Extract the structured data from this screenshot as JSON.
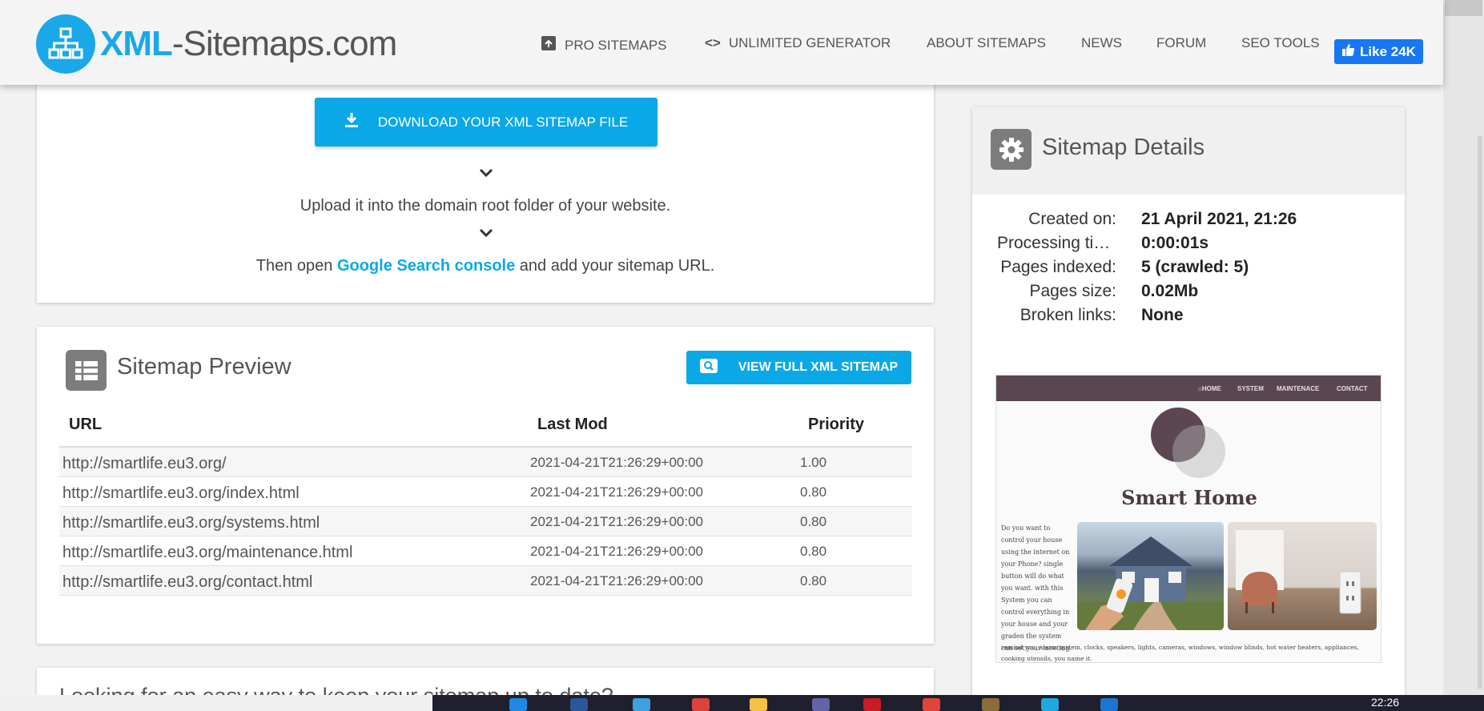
{
  "header": {
    "logo_part1": "XML",
    "logo_part2": "-Sitemaps.com",
    "nav": [
      {
        "label": "PRO SITEMAPS",
        "icon": "box-icon"
      },
      {
        "label": "UNLIMITED GENERATOR",
        "icon": "code-icon"
      },
      {
        "label": "ABOUT SITEMAPS"
      },
      {
        "label": "NEWS"
      },
      {
        "label": "FORUM"
      },
      {
        "label": "SEO TOOLS"
      }
    ],
    "fb_like": "Like 24K"
  },
  "download": {
    "button_label": "DOWNLOAD YOUR XML SITEMAP FILE",
    "step_upload": "Upload it into the domain root folder of your website.",
    "step_open_pre": "Then open ",
    "step_open_link": "Google Search console",
    "step_open_post": " and add your sitemap URL."
  },
  "preview": {
    "title": "Sitemap Preview",
    "view_button": "VIEW FULL XML SITEMAP",
    "columns": [
      "URL",
      "Last Mod",
      "Priority"
    ],
    "rows": [
      {
        "url": "http://smartlife.eu3.org/",
        "lastmod": "2021-04-21T21:26:29+00:00",
        "priority": "1.00"
      },
      {
        "url": "http://smartlife.eu3.org/index.html",
        "lastmod": "2021-04-21T21:26:29+00:00",
        "priority": "0.80"
      },
      {
        "url": "http://smartlife.eu3.org/systems.html",
        "lastmod": "2021-04-21T21:26:29+00:00",
        "priority": "0.80"
      },
      {
        "url": "http://smartlife.eu3.org/maintenance.html",
        "lastmod": "2021-04-21T21:26:29+00:00",
        "priority": "0.80"
      },
      {
        "url": "http://smartlife.eu3.org/contact.html",
        "lastmod": "2021-04-21T21:26:29+00:00",
        "priority": "0.80"
      }
    ]
  },
  "details": {
    "title": "Sitemap Details",
    "items": [
      {
        "label": "Created on:",
        "value": "21 April 2021, 21:26"
      },
      {
        "label": "Processing ti…",
        "value": "0:00:01s"
      },
      {
        "label": "Pages indexed:",
        "value": "5 (crawled: 5)"
      },
      {
        "label": "Pages size:",
        "value": "0.02Mb"
      },
      {
        "label": "Broken links:",
        "value": "None"
      }
    ]
  },
  "thumbnail": {
    "nav": [
      "HOME",
      "SYSTEM",
      "MAINTENACE",
      "CONTACT"
    ],
    "title": "Smart Home",
    "paragraph": "Do you want to control your house using the internet on your Phone? single button will do what you want. with this System you can control everything in your house and your graden the system can set your meeting.",
    "footer": "remind you, alarm system, clocks, speakers, lights, cameras, windows, window blinds, hot water heaters, appliances, cooking utensils, you name it."
  },
  "next_section": {
    "title": "Looking for an easy way to keep your sitemap up to date?"
  },
  "taskbar": {
    "time": "22:26"
  },
  "colors": {
    "accent": "#0ba8e8",
    "facebook": "#1877f2",
    "thumb_nav": "#5a4651"
  }
}
